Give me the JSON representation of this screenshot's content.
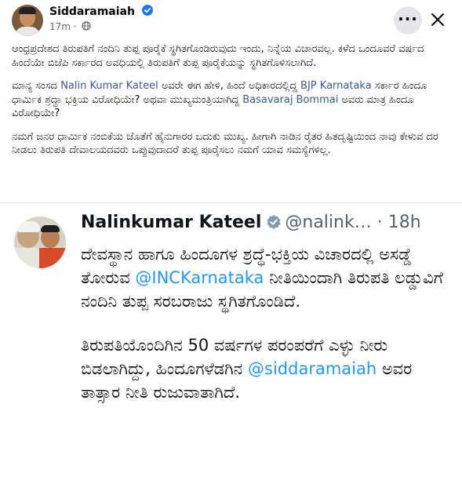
{
  "post": {
    "author": "Siddaramaiah",
    "time": "17m",
    "separator": "·",
    "paragraphs": [
      {
        "parts": [
          {
            "t": "ಆಂಧ್ರಪ್ರದೇಶದ ತಿರುಪತಿಗೆ ನಂದಿನಿ ತುಪ್ಪ ಪೂರೈಕೆ ಸ್ಥಗಿತಗೊಂಡಿರುವುದು ಇಂದು, ನಿನ್ನೆಯ ವಿಚಾರವಲ್ಲ. ಕಳೆದ ಒಂದೂವರೆ ವರ್ಷದ ಹಿಂದೆಯೇ ಬಿಜೆಪಿ ಸರ್ಕಾರದ ಅವಧಿಯಲ್ಲಿ ತಿರುಪತಿಗೆ ತುಪ್ಪ ಪೂರೈಕೆಯನ್ನು ಸ್ಥಗಿತಗೊಳಿಸಲಾಗಿದೆ.",
            "link": false
          }
        ]
      },
      {
        "parts": [
          {
            "t": "ಮಾನ್ಯ ಸಂಸದ ",
            "link": false
          },
          {
            "t": "Nalin Kumar Kateel",
            "link": true
          },
          {
            "t": " ಅವರೇ ಈಗ ಹೇಳಿ, ಹಿಂದೆ ಅಧಿಕಾರದಲ್ಲಿದ್ದ ",
            "link": false
          },
          {
            "t": "BJP Karnataka",
            "link": true
          },
          {
            "t": " ಸರ್ಕಾರ ಹಿಂದೂ ಧಾರ್ಮಿಕ ಶ್ರದ್ಧಾ ಭಕ್ತಿಯ ವಿರೋಧಿಯೇ? ಅಥವಾ ಮುಖ್ಯಮಂತ್ರಿಯಾಗಿದ್ದ ",
            "link": false
          },
          {
            "t": "Basavaraj Bommai",
            "link": true
          },
          {
            "t": " ಅವರು ಮಾತ್ರ ಹಿಂದೂ ವಿರೋಧಿಯೇ?",
            "link": false
          }
        ]
      },
      {
        "parts": [
          {
            "t": "ನಮಗೆ ಜನರ ಧಾರ್ಮಿಕ ನಂಬಿಕೆಯ ಜೊತೆಗೆ ಹೈನುಗಾರರ ಬದುಕು ಮುಖ್ಯ. ಹೀಗಾಗಿ ನಾಡಿನ ರೈತರ ಹಿತದೃಷ್ಟಿಯಿಂದ ನಾವು ಕೇಳುವ ದರ ನೀಡಲು ತಿರುಪತಿ ದೇವಾಲಯದವರು ಒಪ್ಪುವುದಾದರೆ ತುಪ್ಪ ಪೂರೈಸಲು ನಮಗೆ ಯಾವ ಸಮಸ್ಯೆಗಳಿಲ್ಲ.",
            "link": false
          }
        ]
      }
    ]
  },
  "tweet": {
    "name": "Nalinkumar Kateel",
    "handle": "@nalink…",
    "separator": "·",
    "time": "18h",
    "paragraphs": [
      {
        "parts": [
          {
            "t": "ದೇವಸ್ಥಾನ ಹಾಗೂ ಹಿಂದೂಗಳ ಶ್ರದ್ಧೆ-ಭಕ್ತಿಯ ವಿಚಾರದಲ್ಲಿ ಅಸಡ್ಡೆ ತೋರುವ ",
            "link": false
          },
          {
            "t": "@INCKarnataka",
            "link": true
          },
          {
            "t": " ನೀತಿಯಿಂದಾಗಿ ತಿರುಪತಿ ಲಡ್ಡುವಿಗೆ ನಂದಿನಿ ತುಪ್ಪ ಸರಬರಾಜು ಸ್ಥಗಿತಗೊಂಡಿದೆ.",
            "link": false
          }
        ]
      },
      {
        "parts": [
          {
            "t": "ತಿರುಪತಿಯೊಂದಿಗಿನ 50 ವರ್ಷಗಳ ಪರಂಪರೆಗೆ ಎಳ್ಳು ನೀರು ಬಿಡಲಾಗಿದ್ದು, ಹಿಂದೂಗಳೆಡಗಿನ ",
            "link": false
          },
          {
            "t": "@siddaramaiah",
            "link": true
          },
          {
            "t": " ಅವರ ತಾತ್ಸಾರ ನೀತಿ ರುಜುವಾತಾಗಿದೆ.",
            "link": false
          }
        ]
      }
    ]
  },
  "icons": {
    "more": "more-options-icon",
    "close": "close-icon",
    "verified": "verified-badge-icon",
    "globe": "globe-icon"
  },
  "colors": {
    "facebook_link": "#385898",
    "twitter_link": "#1d9bf0",
    "verified_fb": "#1877f2",
    "verified_x": "#1d9bf0"
  }
}
